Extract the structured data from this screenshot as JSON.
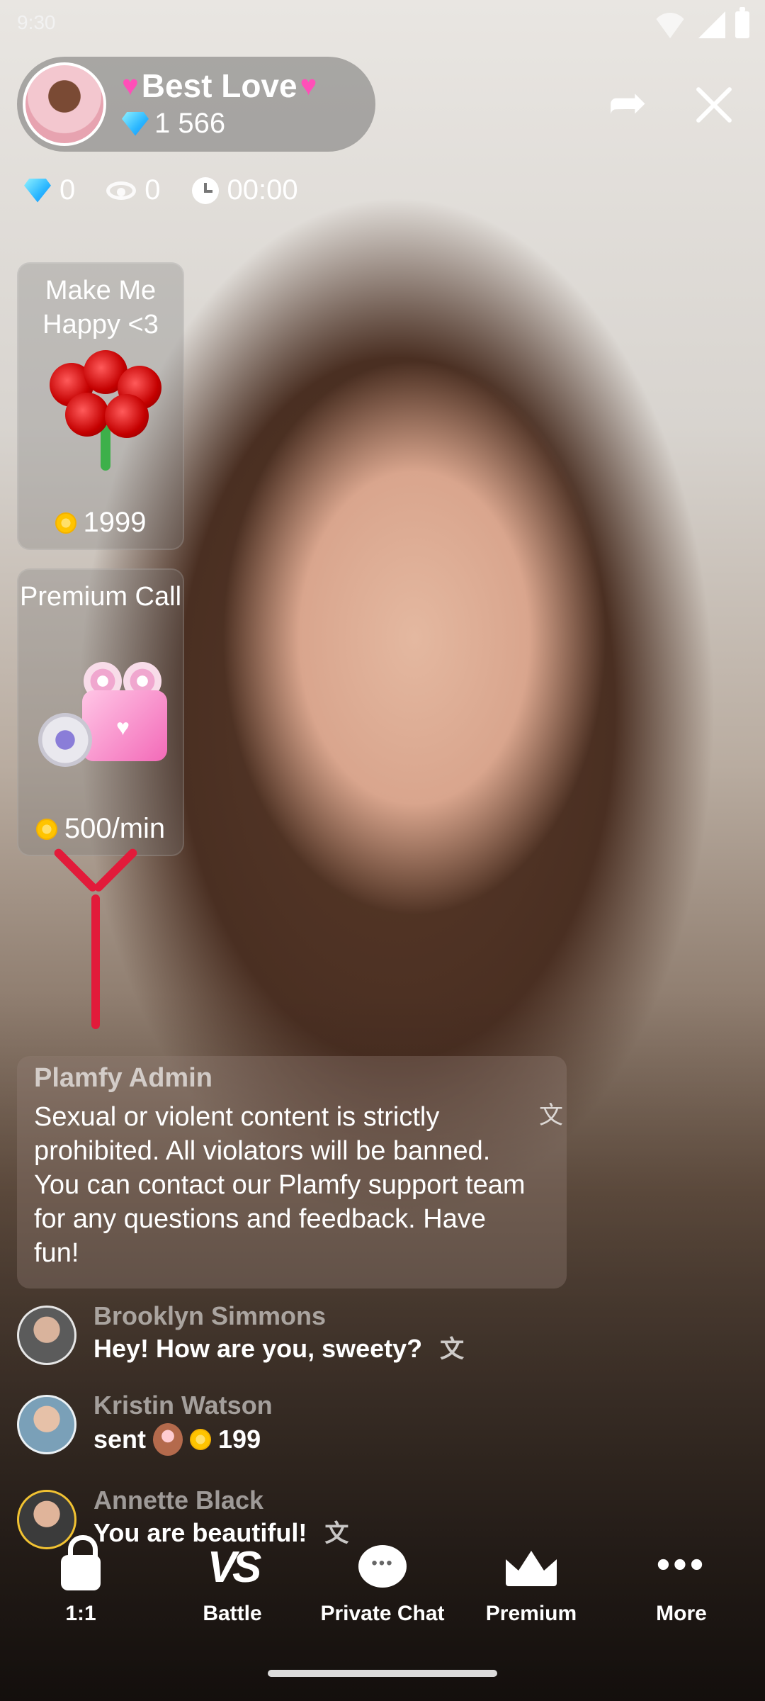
{
  "status_bar": {
    "time": "9:30"
  },
  "host": {
    "name": "Best Love",
    "diamonds": "1 566"
  },
  "stats": {
    "diamonds": "0",
    "viewers": "0",
    "duration": "00:00"
  },
  "offers": [
    {
      "title": "Make Me Happy <3",
      "price": "1999",
      "icon": "roses-bouquet-icon"
    },
    {
      "title": "Premium Call",
      "price": "500/min",
      "icon": "pink-camera-icon"
    }
  ],
  "admin": {
    "name": "Plamfy Admin",
    "message": "Sexual or violent content is strictly prohibited. All violators will be banned. You can contact our Plamfy support team for any questions and feedback. Have fun!"
  },
  "chat": [
    {
      "name": "Brooklyn Simmons",
      "message": "Hey! How are you, sweety?"
    },
    {
      "name": "Kristin Watson",
      "message": "sent",
      "gift_price": "199"
    },
    {
      "name": "Annette Black",
      "message": "You are beautiful!"
    }
  ],
  "bottom_nav": [
    {
      "label": "1:1",
      "icon": "lock-icon"
    },
    {
      "label": "Battle",
      "icon": "vs-icon"
    },
    {
      "label": "Private Chat",
      "icon": "chat-bubble-icon"
    },
    {
      "label": "Premium",
      "icon": "crown-icon"
    },
    {
      "label": "More",
      "icon": "more-dots-icon"
    }
  ],
  "colors": {
    "accent_red": "#e21b3a",
    "heart_pink": "#ff4fb8",
    "coin_gold": "#ffc400",
    "diamond_blue": "#2ab6ff"
  }
}
